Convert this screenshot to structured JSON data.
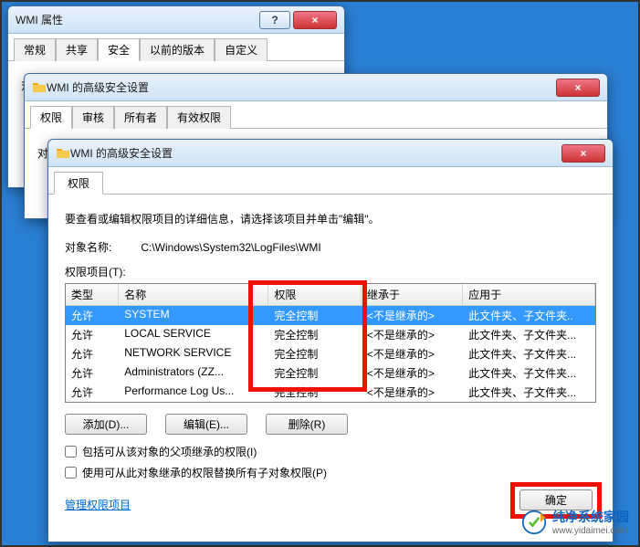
{
  "window1": {
    "title": "WMI 属性",
    "tabs": [
      "常规",
      "共享",
      "安全",
      "以前的版本",
      "自定义"
    ],
    "active_tab": 2,
    "object_label": "对象名称:"
  },
  "window2": {
    "title": "WMI 的高级安全设置",
    "tabs": [
      "权限",
      "审核",
      "所有者",
      "有效权限"
    ],
    "active_tab": 0,
    "object_label": "对象名称:"
  },
  "window3": {
    "title": "WMI 的高级安全设置",
    "tabs": [
      "权限"
    ],
    "active_tab": 0,
    "instruction": "要查看或编辑权限项目的详细信息，请选择该项目并单击\"编辑\"。",
    "object_label": "对象名称:",
    "object_value": "C:\\Windows\\System32\\LogFiles\\WMI",
    "perm_list_label": "权限项目(T):",
    "columns": {
      "type": "类型",
      "name": "名称",
      "perm": "权限",
      "inherit": "继承于",
      "apply": "应用于"
    },
    "rows": [
      {
        "type": "允许",
        "name": "SYSTEM",
        "perm": "完全控制",
        "inherit": "<不是继承的>",
        "apply": "此文件夹、子文件夹..",
        "selected": true
      },
      {
        "type": "允许",
        "name": "LOCAL SERVICE",
        "perm": "完全控制",
        "inherit": "<不是继承的>",
        "apply": "此文件夹、子文件夹..."
      },
      {
        "type": "允许",
        "name": "NETWORK SERVICE",
        "perm": "完全控制",
        "inherit": "<不是继承的>",
        "apply": "此文件夹、子文件夹..."
      },
      {
        "type": "允许",
        "name": "Administrators (ZZ...",
        "perm": "完全控制",
        "inherit": "<不是继承的>",
        "apply": "此文件夹、子文件夹..."
      },
      {
        "type": "允许",
        "name": "Performance Log Us...",
        "perm": "完全控制",
        "inherit": "<不是继承的>",
        "apply": "此文件夹、子文件夹..."
      }
    ],
    "buttons": {
      "add": "添加(D)...",
      "edit": "编辑(E)...",
      "remove": "删除(R)"
    },
    "chk1": "包括可从该对象的父项继承的权限(I)",
    "chk2": "使用可从此对象继承的权限替换所有子对象权限(P)",
    "manage_link": "管理权限项目",
    "ok": "确定"
  },
  "watermark": {
    "name": "纯净系统家园",
    "url": "www.yidaimei.com"
  }
}
